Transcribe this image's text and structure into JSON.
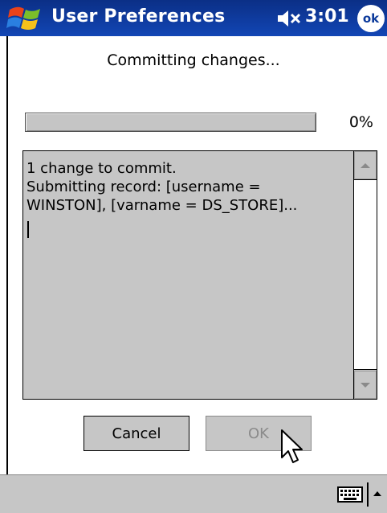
{
  "titlebar": {
    "title": "User Preferences",
    "time": "3:01",
    "ok_label": "ok",
    "start_icon": "windows-flag-icon",
    "volume_icon": "speaker-muted-icon",
    "color": "#0c3a9b"
  },
  "dialog": {
    "status": "Committing changes...",
    "progress": {
      "percent_text": "0%",
      "value": 0
    },
    "log_lines": [
      "1 change to commit.",
      "Submitting record: [username =",
      "WINSTON], [varname = DS_STORE]..."
    ],
    "buttons": {
      "cancel": "Cancel",
      "ok": "OK"
    }
  },
  "bottombar": {
    "keyboard_icon": "keyboard-icon",
    "sip_arrow_icon": "arrow-up-icon"
  }
}
